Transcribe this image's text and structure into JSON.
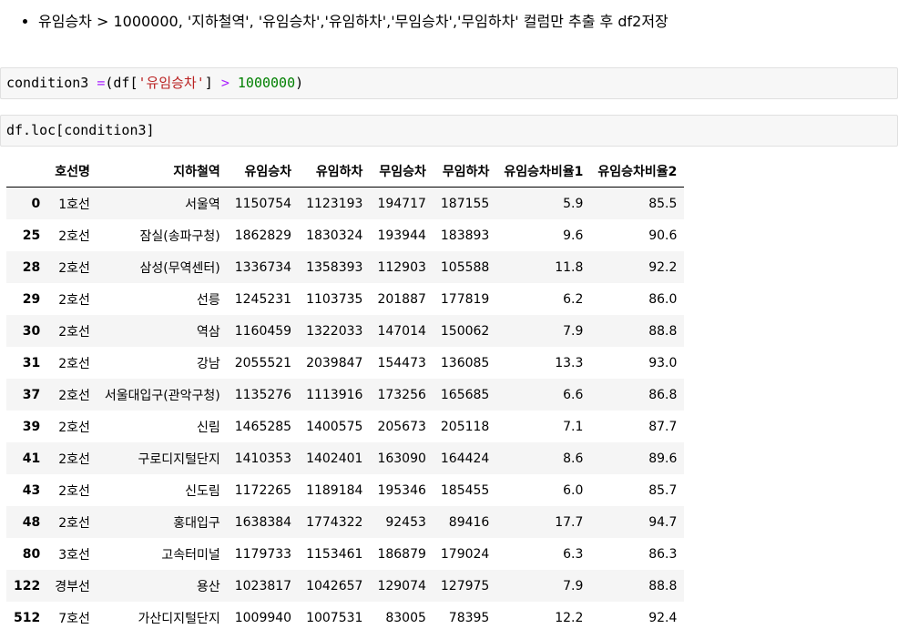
{
  "markdown": {
    "bullet": "유임승차 > 1000000, '지하철역', '유임승차','유임하차','무임승차','무임하차' 컬럼만 추출 후 df2저장"
  },
  "cells": [
    {
      "tokens": [
        {
          "text": "condition3 ",
          "cls": ""
        },
        {
          "text": "=",
          "cls": "op"
        },
        {
          "text": "(df[",
          "cls": ""
        },
        {
          "text": "'유임승차'",
          "cls": "str"
        },
        {
          "text": "] ",
          "cls": ""
        },
        {
          "text": ">",
          "cls": "op"
        },
        {
          "text": " ",
          "cls": ""
        },
        {
          "text": "1000000",
          "cls": "num"
        },
        {
          "text": ")",
          "cls": ""
        }
      ]
    },
    {
      "tokens": [
        {
          "text": "df.loc[condition3]",
          "cls": ""
        }
      ]
    }
  ],
  "table": {
    "columns": [
      "",
      "호선명",
      "지하철역",
      "유임승차",
      "유임하차",
      "무임승차",
      "무임하차",
      "유임승차비율1",
      "유임승차비율2"
    ],
    "rows": [
      [
        "0",
        "1호선",
        "서울역",
        "1150754",
        "1123193",
        "194717",
        "187155",
        "5.9",
        "85.5"
      ],
      [
        "25",
        "2호선",
        "잠실(송파구청)",
        "1862829",
        "1830324",
        "193944",
        "183893",
        "9.6",
        "90.6"
      ],
      [
        "28",
        "2호선",
        "삼성(무역센터)",
        "1336734",
        "1358393",
        "112903",
        "105588",
        "11.8",
        "92.2"
      ],
      [
        "29",
        "2호선",
        "선릉",
        "1245231",
        "1103735",
        "201887",
        "177819",
        "6.2",
        "86.0"
      ],
      [
        "30",
        "2호선",
        "역삼",
        "1160459",
        "1322033",
        "147014",
        "150062",
        "7.9",
        "88.8"
      ],
      [
        "31",
        "2호선",
        "강남",
        "2055521",
        "2039847",
        "154473",
        "136085",
        "13.3",
        "93.0"
      ],
      [
        "37",
        "2호선",
        "서울대입구(관악구청)",
        "1135276",
        "1113916",
        "173256",
        "165685",
        "6.6",
        "86.8"
      ],
      [
        "39",
        "2호선",
        "신림",
        "1465285",
        "1400575",
        "205673",
        "205118",
        "7.1",
        "87.7"
      ],
      [
        "41",
        "2호선",
        "구로디지털단지",
        "1410353",
        "1402401",
        "163090",
        "164424",
        "8.6",
        "89.6"
      ],
      [
        "43",
        "2호선",
        "신도림",
        "1172265",
        "1189184",
        "195346",
        "185455",
        "6.0",
        "85.7"
      ],
      [
        "48",
        "2호선",
        "홍대입구",
        "1638384",
        "1774322",
        "92453",
        "89416",
        "17.7",
        "94.7"
      ],
      [
        "80",
        "3호선",
        "고속터미널",
        "1179733",
        "1153461",
        "186879",
        "179024",
        "6.3",
        "86.3"
      ],
      [
        "122",
        "경부선",
        "용산",
        "1023817",
        "1042657",
        "129074",
        "127975",
        "7.9",
        "88.8"
      ],
      [
        "512",
        "7호선",
        "가산디지털단지",
        "1009940",
        "1007531",
        "83005",
        "78395",
        "12.2",
        "92.4"
      ]
    ]
  }
}
